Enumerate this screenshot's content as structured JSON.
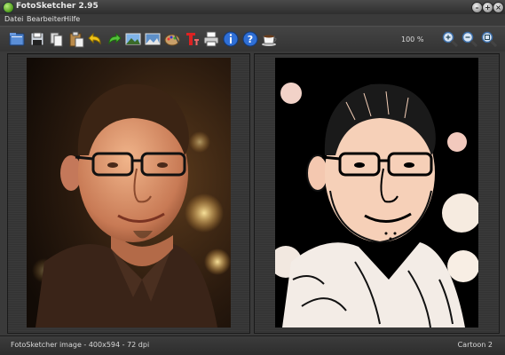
{
  "window": {
    "title": "FotoSketcher 2.95"
  },
  "menu": {
    "items": [
      "Datei",
      "Bearbeiten",
      "Hilfe"
    ]
  },
  "toolbar": {
    "icons": [
      "open-folder-icon",
      "save-icon",
      "copy-icon",
      "paste-icon",
      "undo-icon",
      "redo-icon",
      "image-icon",
      "compare-image-icon",
      "palette-icon",
      "text-icon",
      "print-icon",
      "info-icon",
      "help-icon",
      "coffee-icon",
      "zoom-in-icon",
      "zoom-out-icon",
      "zoom-fit-icon"
    ],
    "zoom_label": "100 %"
  },
  "status": {
    "left": "FotoSketcher image - 400x594 - 72 dpi",
    "right": "Cartoon 2"
  }
}
